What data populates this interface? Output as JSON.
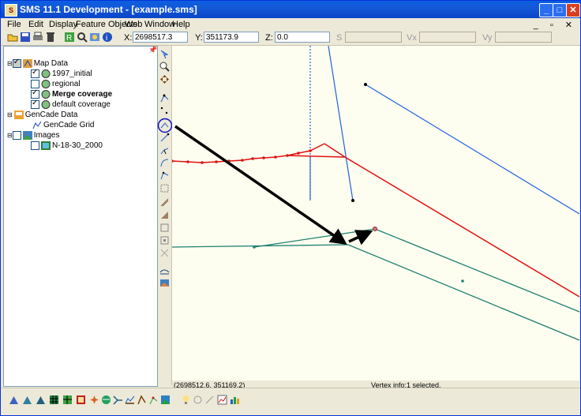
{
  "window": {
    "title": "SMS 11.1 Development - [example.sms]",
    "app_icon_text": "S"
  },
  "title_buttons": {
    "minimize": "_",
    "maximize": "□",
    "close": "✕"
  },
  "menu": [
    "File",
    "Edit",
    "Display",
    "Feature Objects",
    "Web",
    "Window",
    "Help"
  ],
  "mdi_controls": "_ ▫ ✕",
  "coords": {
    "x_label": "X:",
    "x_value": "2698517.3",
    "y_label": "Y:",
    "y_value": "351173.9",
    "z_label": "Z:",
    "z_value": "0.0",
    "s_label": "S",
    "vx_label": "Vx",
    "vy_label": "Vy"
  },
  "pin_icon": "pin-icon",
  "tree": {
    "map_data": "Map Data",
    "cov_1997": "1997_initial",
    "regional": "regional",
    "merge": "Merge coverage",
    "default": "default coverage",
    "gencade_data": "GenCade Data",
    "gencade_grid": "GenCade Grid",
    "images": "Images",
    "image1": "N-18-30_2000"
  },
  "status": {
    "coords": "(2698512.6, 351169.2)",
    "vertex_info": "Vertex info:1 selected."
  },
  "colors": {
    "titlebar": "#0a5fe0",
    "canvas": "#fefef0",
    "blue_arc": "#2060e0",
    "red_arc": "#e01010",
    "green_arc": "#208070",
    "annotation_arrow": "#000000"
  }
}
